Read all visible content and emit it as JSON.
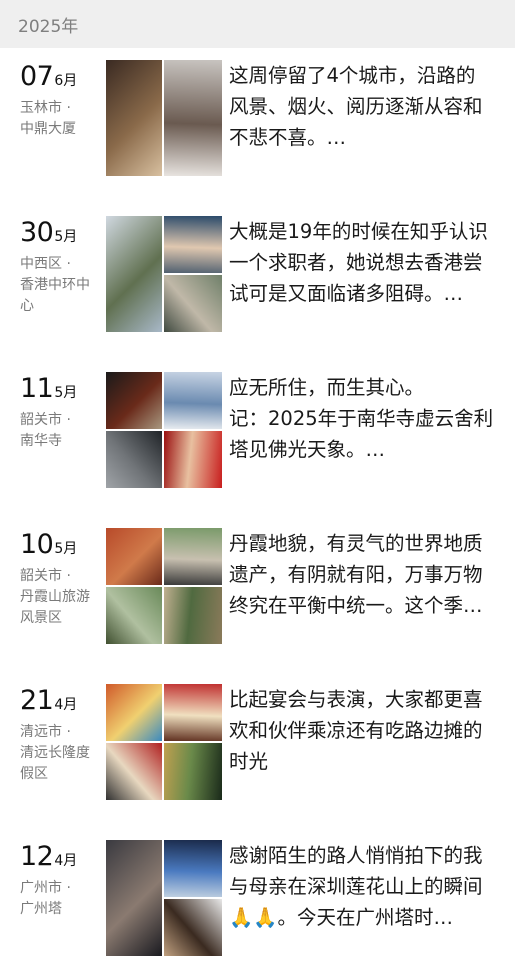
{
  "header": {
    "year": "2025年"
  },
  "entries": [
    {
      "day": "07",
      "month": "6月",
      "city": "玉林市",
      "place": "中鼎大厦",
      "text": [
        "这周停留了4个城市，沿路的",
        "风景、烟火、阅历逐渐从容和",
        "不悲不喜。…"
      ],
      "layout": "2col",
      "photos": [
        "mall-interior",
        "atrium-stairs"
      ]
    },
    {
      "day": "30",
      "month": "5月",
      "city": "中西区",
      "place": "香港中环中心",
      "text": [
        "大概是19年的时候在知乎认识",
        "一个求职者，她说想去香港尝",
        "试可是又面临诸多阻碍。…"
      ],
      "layout": "3",
      "photos": [
        "city-skyline",
        "group-photo",
        "street-view"
      ]
    },
    {
      "day": "11",
      "month": "5月",
      "city": "韶关市",
      "place": "南华寺",
      "text": [
        "应无所住，而生其心。",
        "记：2025年于南华寺虚云舍利",
        "塔见佛光天象。…"
      ],
      "layout": "4",
      "photos": [
        "temple-eaves",
        "calligraphy-blue",
        "night-sky",
        "red-calligraphy"
      ]
    },
    {
      "day": "10",
      "month": "5月",
      "city": "韶关市",
      "place": "丹霞山旅游风景区",
      "text": [
        "丹霞地貌，有灵气的世界地质",
        "遗产，有阴就有阳，万事万物",
        "终究在平衡中统一。这个季…"
      ],
      "layout": "4",
      "photos": [
        "red-cliff",
        "group-hike",
        "mountain-view",
        "wooden-path"
      ]
    },
    {
      "day": "21",
      "month": "4月",
      "city": "清远市",
      "place": "清远长隆度假区",
      "text": [
        "比起宴会与表演，大家都更喜",
        "欢和伙伴乘凉还有吃路边摊的",
        "时光"
      ],
      "layout": "4",
      "photos": [
        "resort-hall",
        "banquet-stage",
        "team-photo",
        "night-market"
      ]
    },
    {
      "day": "12",
      "month": "4月",
      "city": "广州市",
      "place": "广州塔",
      "text": [
        "感谢陌生的路人悄悄拍下的我",
        "与母亲在深圳莲花山上的瞬间",
        "🙏🙏。今天在广州塔时…"
      ],
      "layout": "3",
      "photos": [
        "dusk-silhouettes",
        "canton-tower",
        "photo-grid"
      ]
    }
  ],
  "palettes": {
    "mall-interior": [
      "#3a2a22",
      "#8a6a4a",
      "#d8c0a0"
    ],
    "atrium-stairs": [
      "#c8c4c0",
      "#6a5a50",
      "#e8e4e0"
    ],
    "city-skyline": [
      "#d0d8e0",
      "#607050",
      "#a8b8c8"
    ],
    "group-photo": [
      "#2a4a6a",
      "#e0c8b0",
      "#506070"
    ],
    "street-view": [
      "#70806a",
      "#c0b8a8",
      "#404a40"
    ],
    "temple-eaves": [
      "#1a1a1a",
      "#6a2a1a",
      "#a89880"
    ],
    "calligraphy-blue": [
      "#c8d4e4",
      "#6a8ab0",
      "#e8ecf0"
    ],
    "night-sky": [
      "#202428",
      "#707478",
      "#a0a4a8"
    ],
    "red-calligraphy": [
      "#c81e1e",
      "#e8c0a0",
      "#9a1010"
    ],
    "red-cliff": [
      "#b84a2a",
      "#d07a4a",
      "#6a2a1a"
    ],
    "group-hike": [
      "#7a9a6a",
      "#c8c0b0",
      "#3a3a3a"
    ],
    "mountain-view": [
      "#6a8a5a",
      "#b0c0a0",
      "#405030"
    ],
    "wooden-path": [
      "#8a7a5a",
      "#506a40",
      "#c0b090"
    ],
    "resort-hall": [
      "#d05a2a",
      "#f0d070",
      "#3a8ac0"
    ],
    "banquet-stage": [
      "#c03030",
      "#f0e0c0",
      "#603020"
    ],
    "team-photo": [
      "#b02020",
      "#e8d8c0",
      "#303030"
    ],
    "night-market": [
      "#1a2a1a",
      "#6a8a4a",
      "#c0a050"
    ],
    "dusk-silhouettes": [
      "#3a3a40",
      "#8a7a70",
      "#1a1a20"
    ],
    "canton-tower": [
      "#1a2a4a",
      "#4a7ac0",
      "#c0d0e0"
    ],
    "photo-grid": [
      "#e8e8e8",
      "#3a2a20",
      "#c0a080"
    ]
  }
}
